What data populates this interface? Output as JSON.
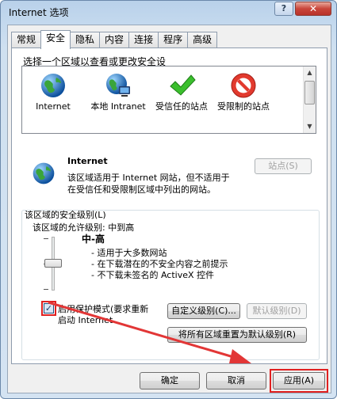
{
  "window": {
    "title": "Internet 选项",
    "help_label": "?",
    "close_label": "✕"
  },
  "tabs": [
    {
      "label": "常规"
    },
    {
      "label": "安全"
    },
    {
      "label": "隐私"
    },
    {
      "label": "内容"
    },
    {
      "label": "连接"
    },
    {
      "label": "程序"
    },
    {
      "label": "高级"
    }
  ],
  "security": {
    "zones_prompt": "选择一个区域以查看或更改安全设",
    "zones": [
      {
        "name": "Internet",
        "icon": "globe-icon"
      },
      {
        "name": "本地 Intranet",
        "icon": "intranet-globe-icon"
      },
      {
        "name": "受信任的站点",
        "icon": "green-checkmark-icon"
      },
      {
        "name": "受限制的站点",
        "icon": "red-restricted-icon"
      }
    ],
    "selected_zone_title": "Internet",
    "selected_zone_desc_1": "该区域适用于 Internet 网站，但不适用于",
    "selected_zone_desc_2": "在受信任和受限制区域中列出的网站。",
    "sites_button": "站点(S)",
    "level_group_label": "该区域的安全级别(L)",
    "allowed_levels": "该区域的允许级别: 中到高",
    "level_name": "中-高",
    "level_bullet_1": "- 适用于大多数网站",
    "level_bullet_2": "- 在下载潜在的不安全内容之前提示",
    "level_bullet_3": "- 不下载未签名的 ActiveX 控件",
    "slider_level": "中-高",
    "protected_mode_checked": true,
    "protected_mode_label_1": "启用保护模式(要求重新",
    "protected_mode_label_2": "启动 Internet",
    "custom_level_button": "自定义级别(C)...",
    "default_level_button": "默认级别(D)",
    "reset_all_button": "将所有区域重置为默认级别(R)"
  },
  "footer": {
    "ok": "确定",
    "cancel": "取消",
    "apply": "应用(A)"
  }
}
